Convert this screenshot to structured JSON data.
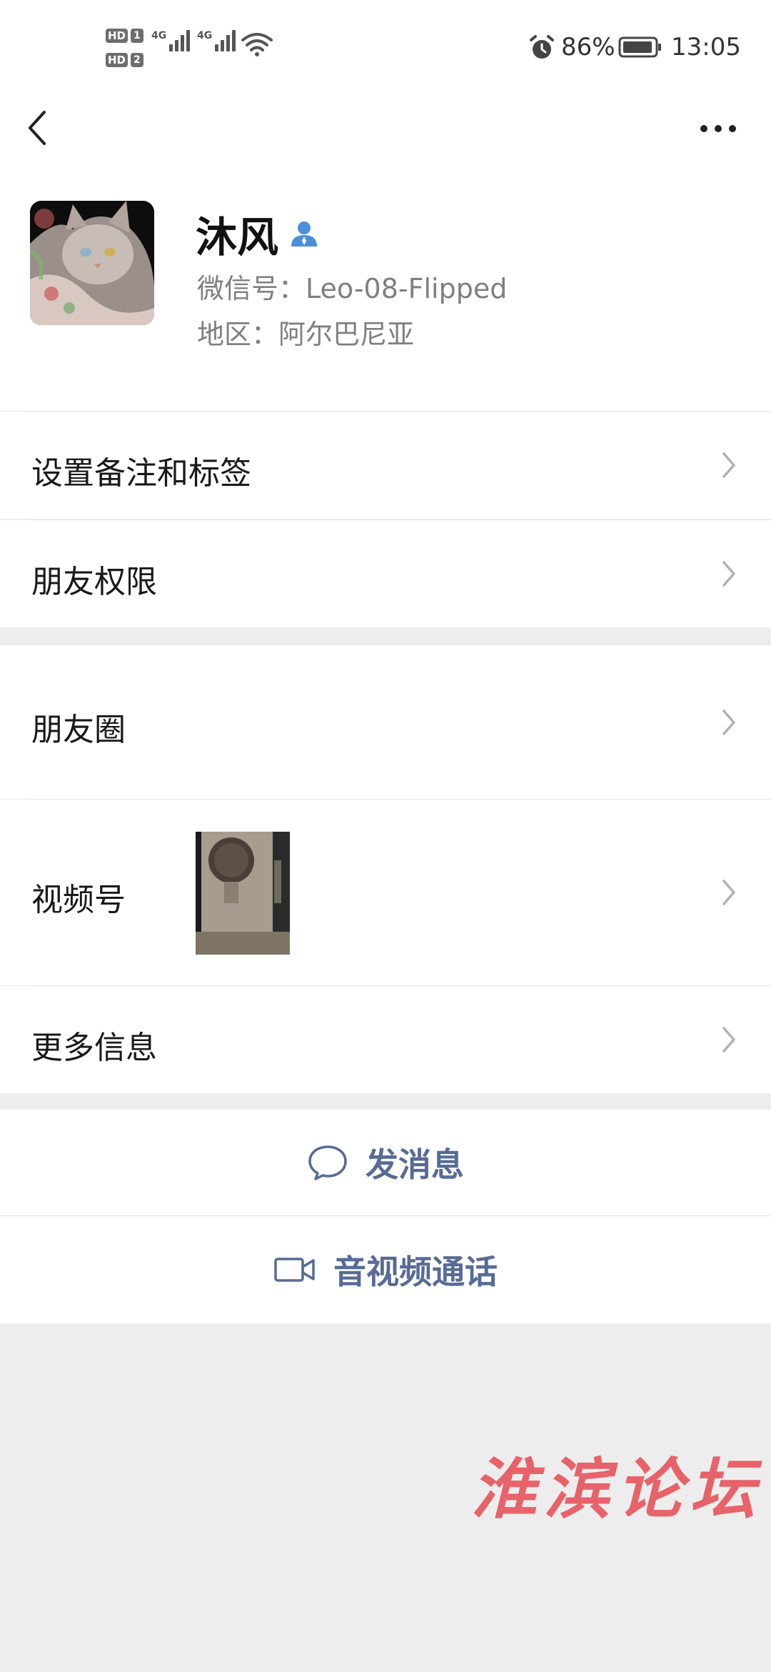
{
  "status_bar": {
    "sim1_label": "HD",
    "sim1_num": "1",
    "sim2_label": "HD",
    "sim2_num": "2",
    "net1": "4G",
    "net2": "4G",
    "battery_percent": "86%",
    "time": "13:05",
    "icons": [
      "wifi-icon",
      "alarm-icon",
      "battery-icon"
    ]
  },
  "nav": {
    "back_icon": "chevron-left-icon",
    "more_icon": "more-dots-icon"
  },
  "profile": {
    "nickname": "沐风",
    "wechat_id": "微信号：Leo-08-Flipped",
    "region": "地区：阿尔巴尼亚",
    "badge_icon": "person-icon",
    "badge_color": "#4a90d9"
  },
  "menu": {
    "remark_tags": "设置备注和标签",
    "friend_permissions": "朋友权限",
    "moments": "朋友圈",
    "channels": "视频号",
    "more_info": "更多信息"
  },
  "actions": {
    "send_message": "发消息",
    "video_call": "音视频通话",
    "accent_color": "#576b95"
  },
  "watermark": "淮滨论坛"
}
